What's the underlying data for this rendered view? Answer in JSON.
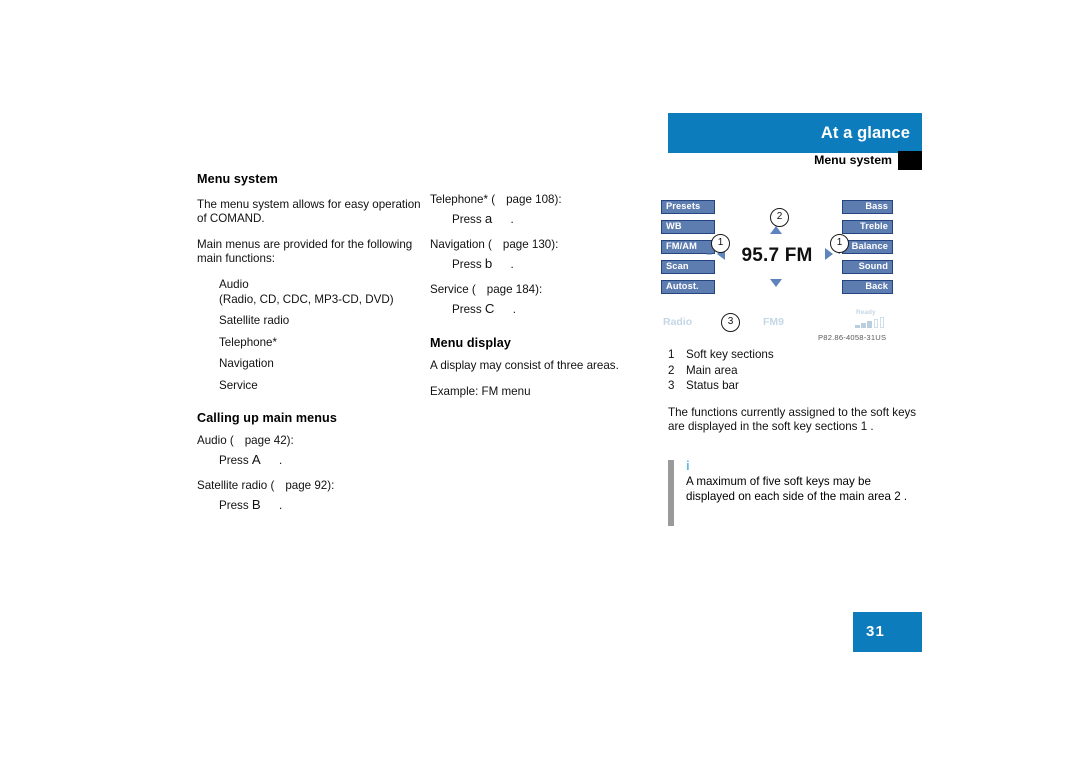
{
  "header": {
    "chapter_title": "At a glance",
    "section_title": "Menu system"
  },
  "left_column": {
    "heading": "Menu system",
    "para1": "The menu system allows for easy operation of COMAND.",
    "para2": "Main menus are provided for the following main functions:",
    "function_list": [
      "Audio",
      "(Radio, CD, CDC, MP3-CD, DVD)",
      "Satellite radio",
      "Telephone*",
      "Navigation",
      "Service"
    ],
    "subheading": "Calling up main menus",
    "entries": [
      {
        "lead_pre": "Audio (",
        "lead_post": "page 42):",
        "step_pre": "Press",
        "key": "A",
        "step_post": "."
      },
      {
        "lead_pre": "Satellite radio (",
        "lead_post": "page 92):",
        "step_pre": "Press",
        "key": "B",
        "step_post": "."
      }
    ]
  },
  "middle_column": {
    "entries": [
      {
        "lead_pre": "Telephone* (",
        "lead_post": "page 108):",
        "step_pre": "Press",
        "key": "a",
        "step_post": "."
      },
      {
        "lead_pre": "Navigation (",
        "lead_post": "page 130):",
        "step_pre": "Press",
        "key": "b",
        "step_post": "."
      },
      {
        "lead_pre": "Service (",
        "lead_post": "page 184):",
        "step_pre": "Press",
        "key": "C",
        "step_post": "."
      }
    ],
    "subheading": "Menu display",
    "para1": "A display may consist of three areas.",
    "para2": "Example: FM menu"
  },
  "figure": {
    "left_soft_keys": [
      "Presets",
      "WB",
      "FM/AM",
      "Scan",
      "Autost."
    ],
    "right_soft_keys": [
      "Bass",
      "Treble",
      "Balance",
      "Sound",
      "Back"
    ],
    "main_area_value": "95.7 FM",
    "minus_sign": "–",
    "plus_sign": "+",
    "callouts": {
      "soft_key_left": "1",
      "soft_key_right": "1",
      "main_area": "2",
      "status_bar": "3"
    },
    "status_bar": {
      "source": "Radio",
      "band": "FM9",
      "signal_label": "Ready",
      "signal_bars_on": 3,
      "signal_bars_total": 5
    },
    "figure_code": "P82.86-4058-31US"
  },
  "right_column": {
    "legend": [
      {
        "num": "1",
        "label": "Soft key sections"
      },
      {
        "num": "2",
        "label": "Main area"
      },
      {
        "num": "3",
        "label": "Status bar"
      }
    ],
    "para_pre": "The functions currently assigned to the soft keys are displayed in the soft key sections",
    "para_ref": "1",
    "para_post": "."
  },
  "note": {
    "icon": "i",
    "text_pre": "A maximum of five soft keys may be displayed on each side of the main area",
    "text_ref": "2",
    "text_post": "."
  },
  "footer": {
    "page_number": "31"
  },
  "colors": {
    "brand_blue": "#0c7cbc",
    "soft_key_fill": "#5d7cb0",
    "soft_key_border": "#24457f",
    "status_text": "#c3d7e6",
    "note_bar": "#9a9a9a",
    "note_icon": "#6ab7e0"
  }
}
